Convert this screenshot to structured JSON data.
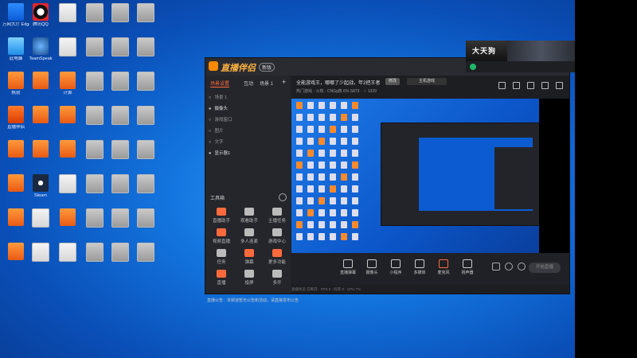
{
  "desktop": {
    "icons": [
      {
        "label": "万网大厅 Edge",
        "icon": "edge-icon"
      },
      {
        "label": "腾讯QQ",
        "icon": "qq-icon"
      },
      {
        "label": "",
        "icon": "file-icon"
      },
      {
        "label": "",
        "icon": "file-icon"
      },
      {
        "label": "",
        "icon": "file-icon"
      },
      {
        "label": "",
        "icon": "file-icon"
      },
      {
        "label": "此电脑",
        "icon": "computer-icon"
      },
      {
        "label": "TeamSpeak",
        "icon": "teamspeak-icon"
      },
      {
        "label": "",
        "icon": "file-icon"
      },
      {
        "label": "",
        "icon": "file-icon"
      },
      {
        "label": "",
        "icon": "file-icon"
      },
      {
        "label": "",
        "icon": "file-icon"
      },
      {
        "label": "帆软",
        "icon": "app-icon"
      },
      {
        "label": "",
        "icon": "app-icon"
      },
      {
        "label": "计算",
        "icon": "app-icon"
      },
      {
        "label": "",
        "icon": "file-icon"
      },
      {
        "label": "",
        "icon": "file-icon"
      },
      {
        "label": "",
        "icon": "file-icon"
      },
      {
        "label": "直播伴侣",
        "icon": "live-icon"
      },
      {
        "label": "",
        "icon": "app-icon"
      },
      {
        "label": "",
        "icon": "app-icon"
      },
      {
        "label": "",
        "icon": "file-icon"
      },
      {
        "label": "",
        "icon": "file-icon"
      },
      {
        "label": "",
        "icon": "file-icon"
      },
      {
        "label": "",
        "icon": "app-icon"
      },
      {
        "label": "",
        "icon": "app-icon"
      },
      {
        "label": "",
        "icon": "app-icon"
      },
      {
        "label": "",
        "icon": "file-icon"
      },
      {
        "label": "",
        "icon": "file-icon"
      },
      {
        "label": "",
        "icon": "file-icon"
      },
      {
        "label": "",
        "icon": "app-icon"
      },
      {
        "label": "Steam",
        "icon": "steam-icon"
      },
      {
        "label": "",
        "icon": "file-icon"
      },
      {
        "label": "",
        "icon": "file-icon"
      },
      {
        "label": "",
        "icon": "file-icon"
      },
      {
        "label": "",
        "icon": "file-icon"
      },
      {
        "label": "",
        "icon": "app-icon"
      },
      {
        "label": "",
        "icon": "file-icon"
      },
      {
        "label": "",
        "icon": "app-icon"
      },
      {
        "label": "",
        "icon": "file-icon"
      },
      {
        "label": "",
        "icon": "file-icon"
      },
      {
        "label": "",
        "icon": "file-icon"
      },
      {
        "label": "",
        "icon": "app-icon"
      },
      {
        "label": "",
        "icon": "file-icon"
      },
      {
        "label": "",
        "icon": "file-icon"
      },
      {
        "label": "",
        "icon": "file-icon"
      },
      {
        "label": "",
        "icon": "file-icon"
      },
      {
        "label": "",
        "icon": "file-icon"
      }
    ]
  },
  "app": {
    "name": "直播伴侣",
    "version": "新版",
    "left_tabs": [
      "场景设置",
      "互动",
      "场景 1"
    ],
    "scenes": [
      {
        "label": "场景 1",
        "visible": false
      },
      {
        "label": "摄像头",
        "visible": true
      },
      {
        "label": "游戏窗口",
        "visible": false
      },
      {
        "label": "图片",
        "visible": false
      },
      {
        "label": "文字",
        "visible": false
      },
      {
        "label": "显示器1",
        "visible": true
      }
    ],
    "tools_title": "工具箱",
    "tools": [
      "直播助手",
      "观看助手",
      "主播任务",
      "视频直播",
      "多人连麦",
      "游戏中心",
      "任务",
      "弹幕",
      "更多功能",
      "直播",
      "投屏",
      "多开"
    ],
    "info_line1": "全能游戏王，哪哪了少起战，年2把王者",
    "edit_label": "修改",
    "main_game": "主机游戏",
    "info_line2": "热门游戏 · 火热 ·  CNGg热  6%  S873  ·  ☆ 1329",
    "bottom_buttons": [
      "直播弹幕",
      "摄像头",
      "小程序",
      "多媒体",
      "麦克风",
      "扬声器"
    ],
    "start_label": "开始直播",
    "status_text": "直播状态  已断开  · FPS 0 · 码率 0 · CPU 7%",
    "notice": "直播公告：本频道暂无公告和活动，请直接发布公告"
  },
  "float_window": {
    "thumb_text": "大天狗"
  }
}
